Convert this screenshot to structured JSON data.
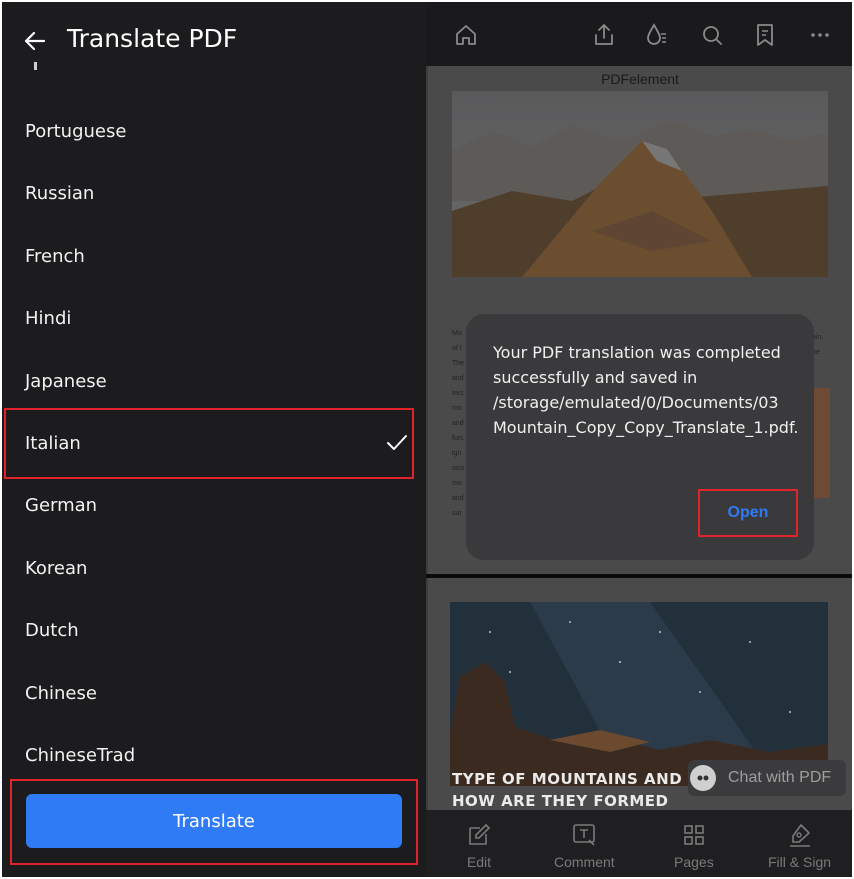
{
  "header": {
    "title": "Translate PDF"
  },
  "languages": [
    {
      "label": "Portuguese"
    },
    {
      "label": "Russian"
    },
    {
      "label": "French"
    },
    {
      "label": "Hindi"
    },
    {
      "label": "Japanese"
    },
    {
      "label": "Italian",
      "selected": true
    },
    {
      "label": "German"
    },
    {
      "label": "Korean"
    },
    {
      "label": "Dutch"
    },
    {
      "label": "Chinese"
    },
    {
      "label": "ChineseTrad"
    }
  ],
  "translate_button": "Translate",
  "document": {
    "header": "PDFelement",
    "section_title": "TYPE OF MOUNTAINS AND HOW ARE THEY FORMED",
    "left_col_text": [
      "Mo",
      "of t",
      "The",
      "and",
      "tect",
      "mo",
      "and",
      "forc",
      "ign",
      "isos",
      "mo",
      "and",
      "sur"
    ],
    "right_col_text": [
      "ain.",
      "he"
    ]
  },
  "dialog": {
    "message": "Your PDF translation was completed successfully and saved in /storage/emulated/0/Documents/03 Mountain_Copy_Copy_Translate_1.pdf.",
    "open_button": "Open"
  },
  "chat": {
    "label": "Chat with PDF"
  },
  "bottom_nav": [
    {
      "label": "Edit",
      "icon": "edit-icon"
    },
    {
      "label": "Comment",
      "icon": "comment-icon"
    },
    {
      "label": "Pages",
      "icon": "pages-icon"
    },
    {
      "label": "Fill & Sign",
      "icon": "fill-sign-icon"
    }
  ],
  "toolbar_icons": [
    "home-icon",
    "share-icon",
    "ocr-icon",
    "search-icon",
    "bookmark-icon",
    "more-icon"
  ],
  "colors": {
    "accent": "#2f7bf6",
    "highlight": "#e0242a",
    "panel": "#1c1c1e"
  }
}
